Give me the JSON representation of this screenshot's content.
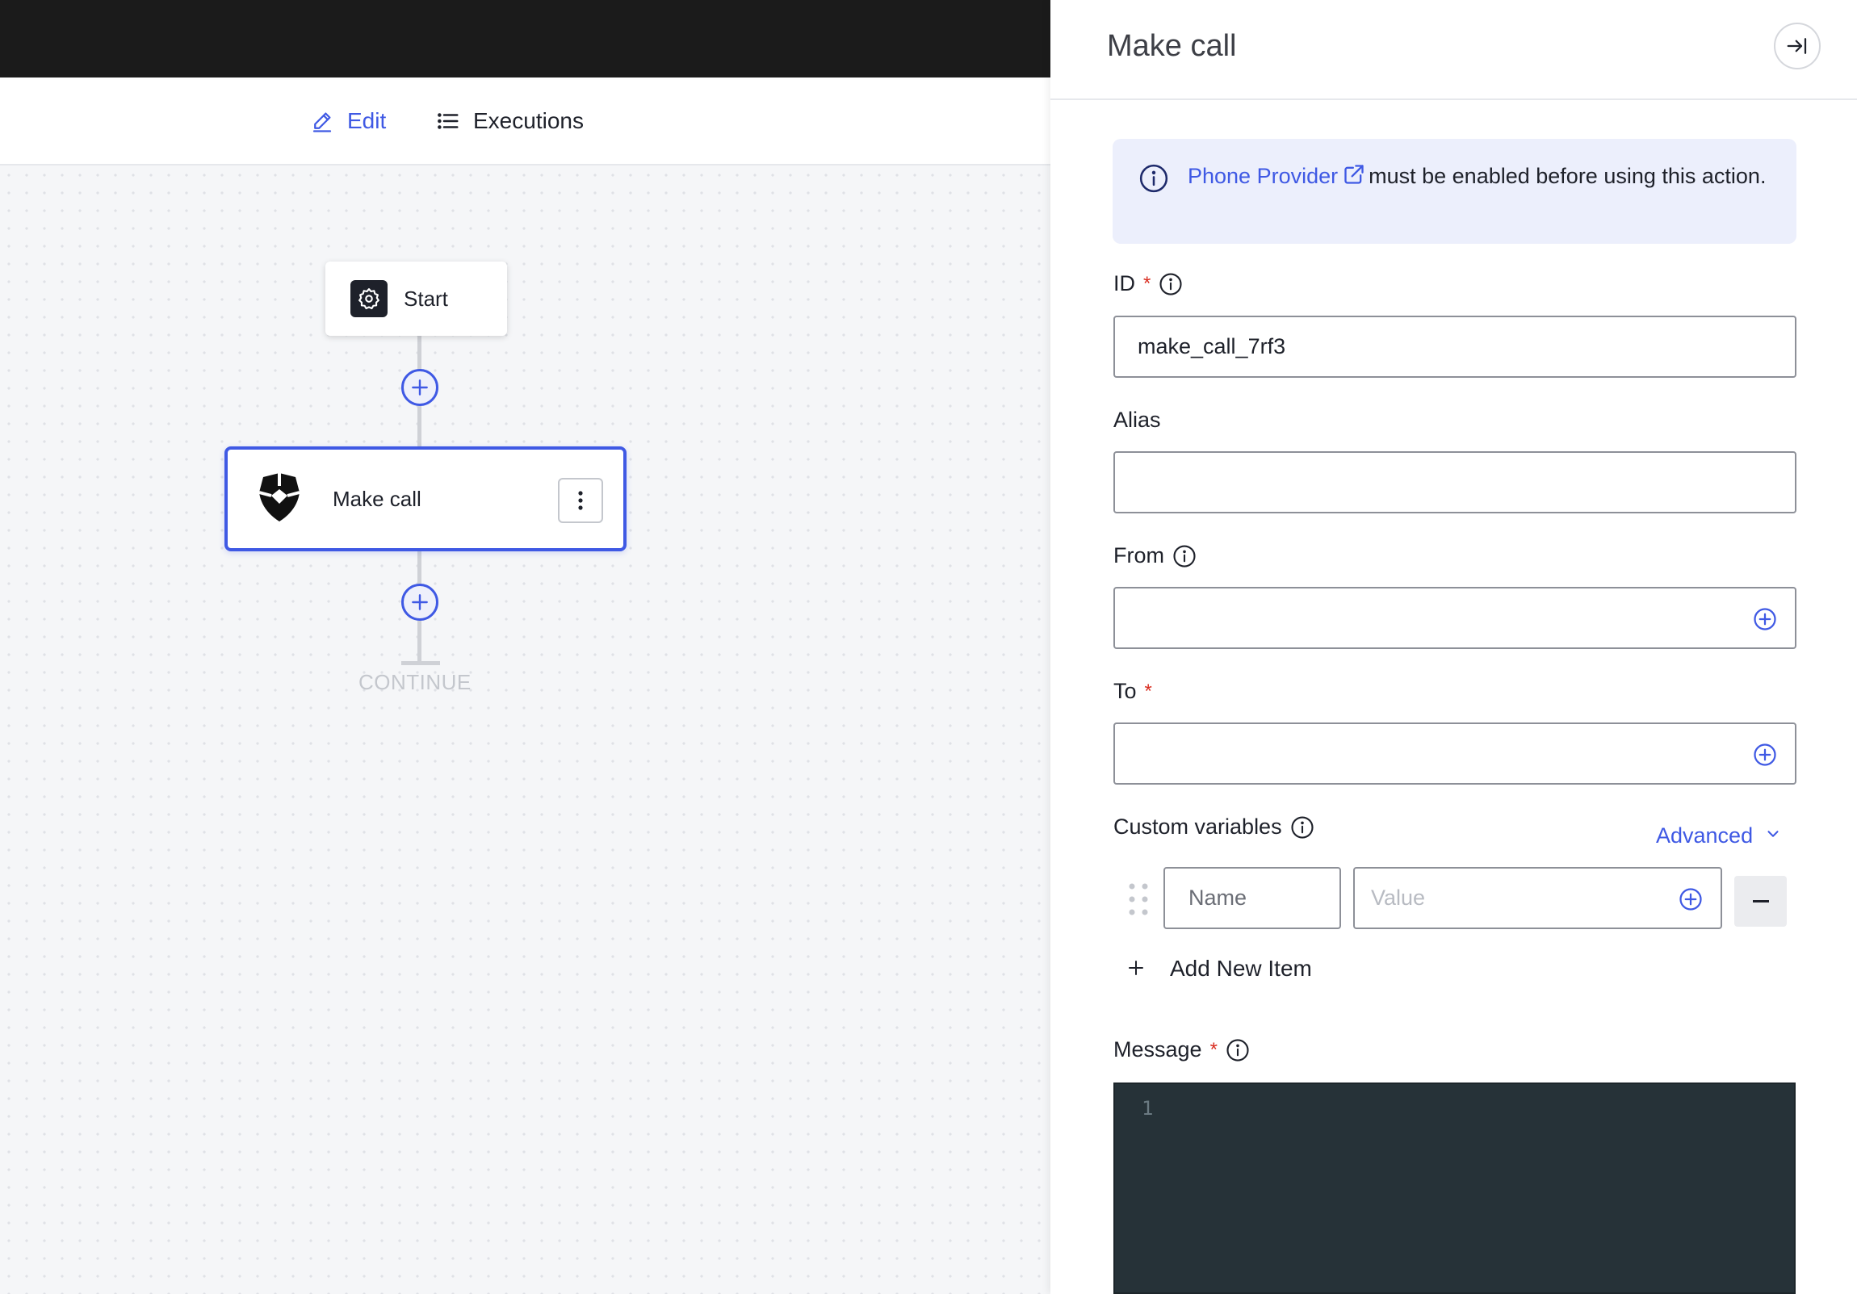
{
  "nav": {
    "edit_label": "Edit",
    "executions_label": "Executions"
  },
  "flow": {
    "start_label": "Start",
    "action_label": "Make call",
    "continue_label": "CONTINUE"
  },
  "panel": {
    "title": "Make call",
    "notice": {
      "link_text": "Phone Provider",
      "text": "must be enabled before using this action."
    },
    "fields": {
      "id": {
        "label": "ID",
        "value": "make_call_7rf3"
      },
      "alias": {
        "label": "Alias",
        "value": ""
      },
      "from": {
        "label": "From",
        "value": ""
      },
      "to": {
        "label": "To",
        "value": ""
      },
      "custom_variables": {
        "label": "Custom variables",
        "advanced_label": "Advanced",
        "name_placeholder": "Name",
        "value_placeholder": "Value",
        "add_item_label": "Add New Item"
      },
      "message": {
        "label": "Message",
        "line_number": "1"
      }
    }
  },
  "colors": {
    "accent": "#3f59e4",
    "required": "#d92d20",
    "topbar": "#1b1b1b",
    "editor_bg": "#263238",
    "notice_bg": "#eceffc"
  }
}
